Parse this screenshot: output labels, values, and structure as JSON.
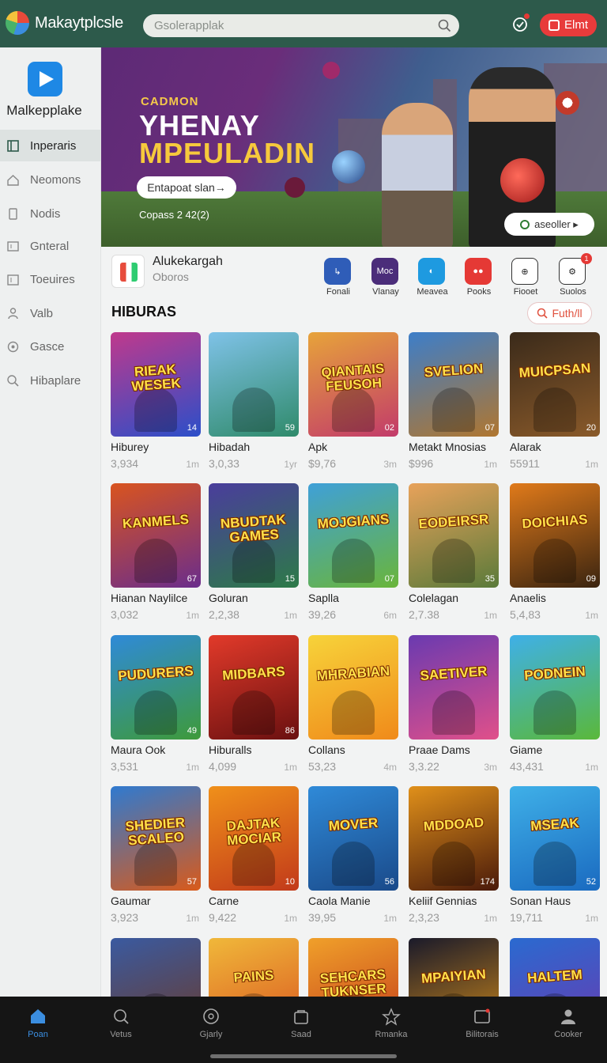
{
  "header": {
    "app_title": "Makaytplcsle",
    "search_placeholder": "Gsolerapplak",
    "action_label": "Elmt",
    "colors": {
      "bar": "#2d5a4b",
      "action": "#e83b3b"
    }
  },
  "sidebar": {
    "brand_name": "Malkepplake",
    "items": [
      {
        "label": "Inperaris",
        "icon": "grid-icon"
      },
      {
        "label": "Neomons",
        "icon": "home-icon"
      },
      {
        "label": "Nodis",
        "icon": "doc-icon"
      },
      {
        "label": "Gnteral",
        "icon": "box-icon"
      },
      {
        "label": "Toeuires",
        "icon": "calendar-icon"
      },
      {
        "label": "Valb",
        "icon": "person-icon"
      },
      {
        "label": "Gasce",
        "icon": "gear-icon"
      },
      {
        "label": "Hibaplare",
        "icon": "search-icon"
      }
    ]
  },
  "banner": {
    "kicker": "CADMON",
    "headline1": "YHENAY",
    "headline2": "MPEULADIN",
    "cta": "Entapoat slan→",
    "footer": "Copass 2 42(2)",
    "pill": "aseoller ▸"
  },
  "featured": {
    "title": "Alukekargah",
    "subtitle": "Oboros",
    "shortcuts": [
      {
        "label": "Fonali",
        "color": "#2f5db8",
        "glyph": "↳"
      },
      {
        "label": "Vlanay",
        "color": "#4b2d7a",
        "glyph": "Moc"
      },
      {
        "label": "Meavea",
        "color": "#1e9ae0",
        "glyph": "◐"
      },
      {
        "label": "Pooks",
        "color": "#e53935",
        "glyph": "●●"
      },
      {
        "label": "Fiooet",
        "color": "#ffffff",
        "glyph": "⊕"
      },
      {
        "label": "Suolos",
        "color": "#ffffff",
        "glyph": "⚙"
      }
    ],
    "badge_count": "1"
  },
  "section": {
    "title": "HIBURAS",
    "filter_label": "Futh/ll"
  },
  "games": [
    {
      "title": "Hiburey",
      "sub": "3,934",
      "meta": "1m",
      "art": "RIEAK WESEK",
      "badge": "14",
      "c1": "#c0398c",
      "c2": "#2b4fc9"
    },
    {
      "title": "Hibadah",
      "sub": "3,0,33",
      "meta": "1yr",
      "art": "",
      "badge": "59",
      "c1": "#7fc2e8",
      "c2": "#2f8a6a"
    },
    {
      "title": "Apk",
      "sub": "$9,76",
      "meta": "3m",
      "art": "QIANTAIS FEUSOH",
      "badge": "02",
      "c1": "#e7a33a",
      "c2": "#c23b6a"
    },
    {
      "title": "Metakt Mnosias",
      "sub": "$996",
      "meta": "1m",
      "art": "SVELION",
      "badge": "07",
      "c1": "#3d7ec9",
      "c2": "#b0762f"
    },
    {
      "title": "Alarak",
      "sub": "55911",
      "meta": "1m",
      "art": "MUICPSAN",
      "badge": "20",
      "c1": "#3a2a1a",
      "c2": "#8a5a2a"
    },
    {
      "title": "Hianan Naylilce",
      "sub": "3,032",
      "meta": "1m",
      "art": "KANMELS",
      "badge": "67",
      "c1": "#d9541f",
      "c2": "#6a2d8c"
    },
    {
      "title": "Goluran",
      "sub": "2,2,38",
      "meta": "1m",
      "art": "NBUDTAK GAMES",
      "badge": "15",
      "c1": "#4a3d9c",
      "c2": "#2d7a48"
    },
    {
      "title": "Saplla",
      "sub": "39,26",
      "meta": "6m",
      "art": "MOJGIANS",
      "badge": "07",
      "c1": "#3fa0d8",
      "c2": "#6ab53a"
    },
    {
      "title": "Colelagan",
      "sub": "2,7.38",
      "meta": "1m",
      "art": "EODEIRSR",
      "badge": "35",
      "c1": "#e8a25a",
      "c2": "#5a7a3a"
    },
    {
      "title": "Anaelis",
      "sub": "5,4,83",
      "meta": "1m",
      "art": "DOICHIAS",
      "badge": "09",
      "c1": "#e07a1a",
      "c2": "#3a2410"
    },
    {
      "title": "Maura Ook",
      "sub": "3,531",
      "meta": "1m",
      "art": "PUDURERS",
      "badge": "49",
      "c1": "#2f8ad8",
      "c2": "#3e9a3a"
    },
    {
      "title": "Hiburalls",
      "sub": "4,099",
      "meta": "1m",
      "art": "MIDBARS",
      "badge": "86",
      "c1": "#e23a2a",
      "c2": "#6a1010"
    },
    {
      "title": "Collans",
      "sub": "53,23",
      "meta": "4m",
      "art": "MHRABIAN",
      "badge": "",
      "c1": "#f7d33a",
      "c2": "#f08a1a"
    },
    {
      "title": "Praae Dams",
      "sub": "3,3.22",
      "meta": "3m",
      "art": "SAETIVER",
      "badge": "",
      "c1": "#6a3ab0",
      "c2": "#e0508a"
    },
    {
      "title": "Giame",
      "sub": "43,431",
      "meta": "1m",
      "art": "PODNEIN",
      "badge": "",
      "c1": "#3fb0e8",
      "c2": "#5ab83a"
    },
    {
      "title": "Gaumar",
      "sub": "3,923",
      "meta": "1m",
      "art": "SHEDIER SCALEO",
      "badge": "57",
      "c1": "#2f7ad0",
      "c2": "#d95a1a"
    },
    {
      "title": "Carne",
      "sub": "9,422",
      "meta": "1m",
      "art": "DAJTAK MOCIAR",
      "badge": "10",
      "c1": "#f0901a",
      "c2": "#c23a1a"
    },
    {
      "title": "Caola Manie",
      "sub": "39,95",
      "meta": "1m",
      "art": "MOVER",
      "badge": "56",
      "c1": "#2f8ad8",
      "c2": "#1a4a8a"
    },
    {
      "title": "Keliif Gennias",
      "sub": "2,3,23",
      "meta": "1m",
      "art": "MDDOAD",
      "badge": "174",
      "c1": "#e0901a",
      "c2": "#4a1a0a"
    },
    {
      "title": "Sonan Haus",
      "sub": "19,711",
      "meta": "1m",
      "art": "MSEAK",
      "badge": "52",
      "c1": "#3fb0e8",
      "c2": "#1a6ac0"
    },
    {
      "title": "",
      "sub": "",
      "meta": "",
      "art": "",
      "badge": "",
      "c1": "#3a5aa0",
      "c2": "#6a3a2a"
    },
    {
      "title": "",
      "sub": "",
      "meta": "",
      "art": "PAINS",
      "badge": "",
      "c1": "#f0b83a",
      "c2": "#d9541f"
    },
    {
      "title": "",
      "sub": "",
      "meta": "",
      "art": "SEHCARS TUKNSER",
      "badge": "",
      "c1": "#f0a02a",
      "c2": "#c23a1a"
    },
    {
      "title": "",
      "sub": "",
      "meta": "",
      "art": "MPAIYIAN",
      "badge": "",
      "c1": "#1a1a2a",
      "c2": "#d08a1a"
    },
    {
      "title": "",
      "sub": "",
      "meta": "",
      "art": "HALTEM",
      "badge": "",
      "c1": "#2a6ad0",
      "c2": "#6a3ab0"
    }
  ],
  "bottom_nav": [
    {
      "label": "Poan",
      "icon": "home-icon",
      "active": true
    },
    {
      "label": "Vetus",
      "icon": "search-icon",
      "active": false
    },
    {
      "label": "Gjarly",
      "icon": "explore-icon",
      "active": false
    },
    {
      "label": "Saad",
      "icon": "bag-icon",
      "active": false
    },
    {
      "label": "Rmanka",
      "icon": "star-icon",
      "active": false
    },
    {
      "label": "Bilitorais",
      "icon": "inbox-icon",
      "active": false
    },
    {
      "label": "Cooker",
      "icon": "profile-icon",
      "active": false
    }
  ]
}
